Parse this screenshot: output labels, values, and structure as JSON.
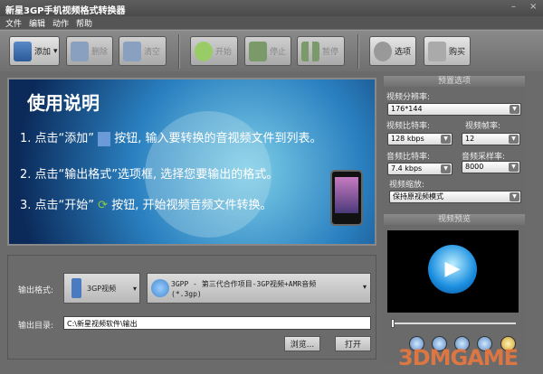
{
  "window": {
    "title": "新星3GP手机视频格式转换器",
    "minimize": "–",
    "close": "×"
  },
  "menu": [
    "文件",
    "编辑",
    "动作",
    "帮助"
  ],
  "toolbar": {
    "add": "添加",
    "delete": "删除",
    "clear": "清空",
    "start": "开始",
    "stop": "停止",
    "pause": "暂停",
    "options": "选项",
    "buy": "购买"
  },
  "banner": {
    "heading": "使用说明",
    "step1a": "1. 点击“添加”",
    "step1b": "按钮, 输入要转换的音视频文件到列表。",
    "step2": "2. 点击“输出格式”选项框, 选择您要输出的格式。",
    "step3a": "3. 点击“开始”",
    "step3b": "按钮, 开始视频音频文件转换。"
  },
  "output": {
    "format_label": "输出格式:",
    "device": "3GP视频",
    "format_line1": "3GPP - 第三代合作项目-3GP视频+AMR音频",
    "format_line2": "(*.3gp)",
    "dir_label": "输出目录:",
    "dir_value": "C:\\新星视频软件\\输出",
    "browse": "浏览...",
    "open": "打开"
  },
  "presets": {
    "header": "预置选项",
    "resolution_label": "视频分辨率:",
    "resolution": "176*144",
    "vbitrate_label": "视频比特率:",
    "vbitrate": "128 kbps",
    "framerate_label": "视频帧率:",
    "framerate": "12",
    "abitrate_label": "音频比特率:",
    "abitrate": "7.4 kbps",
    "samplerate_label": "音频采样率:",
    "samplerate": "8000",
    "scale_label": "视频缩放:",
    "scale": "保持原视频模式"
  },
  "preview": {
    "header": "视频预览",
    "progress": 0
  },
  "watermark": "3DMGAME"
}
